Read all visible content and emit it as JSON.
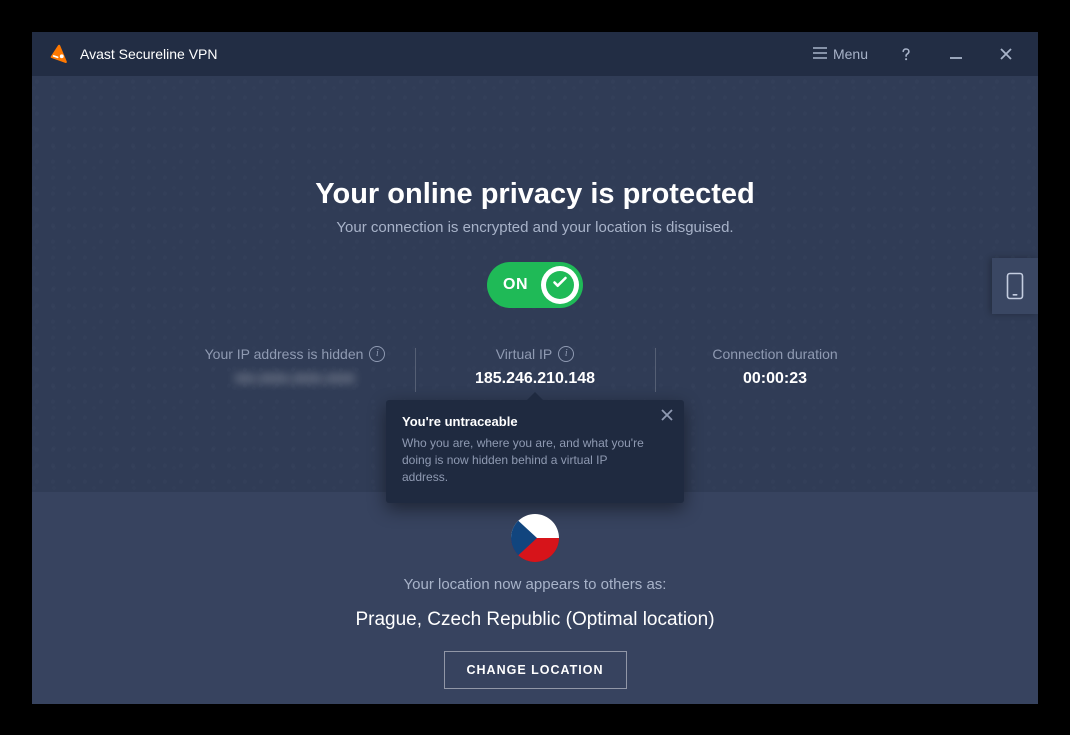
{
  "titlebar": {
    "app_name": "Avast Secureline VPN",
    "menu_label": "Menu"
  },
  "main": {
    "headline": "Your online privacy is protected",
    "subline": "Your connection is encrypted and your location is disguised.",
    "toggle_state": "ON"
  },
  "stats": {
    "ip_hidden": {
      "label": "Your IP address is hidden",
      "value": "●●.●●●.●●●.●●●"
    },
    "virtual_ip": {
      "label": "Virtual IP",
      "value": "185.246.210.148"
    },
    "duration": {
      "label": "Connection duration",
      "value": "00:00:23"
    }
  },
  "tooltip": {
    "title": "You're untraceable",
    "body": "Who you are, where you are, and what you're doing is now hidden behind a virtual IP address."
  },
  "location": {
    "label": "Your location now appears to others as:",
    "value": "Prague, Czech Republic (Optimal location)",
    "change_button": "CHANGE LOCATION"
  }
}
